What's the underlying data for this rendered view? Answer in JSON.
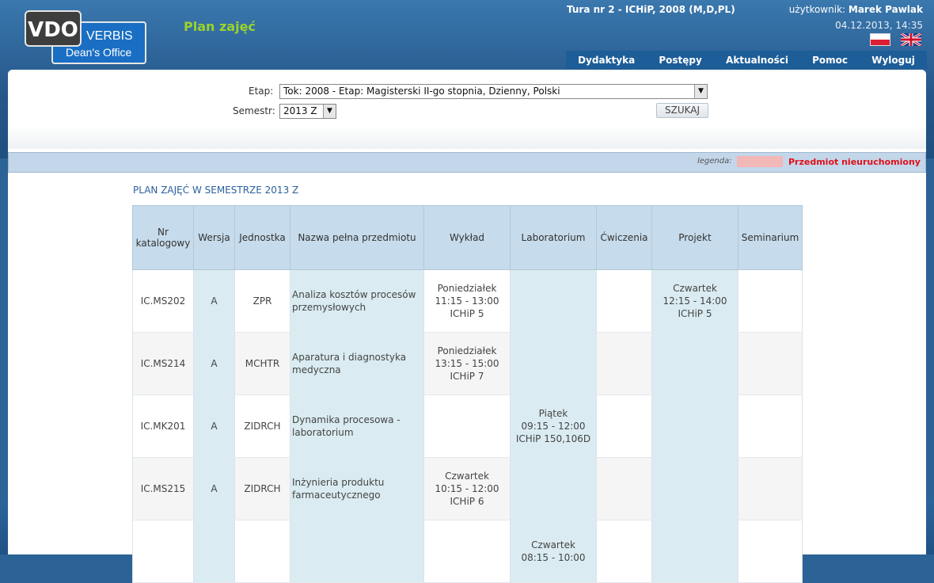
{
  "logo": {
    "vdo": "VDO",
    "verbis": "VERBIS",
    "dean": "Dean's Office"
  },
  "header": {
    "app_title": "Plan zajęć",
    "tura": "Tura nr 2 - ICHiP, 2008 (M,D,PL)",
    "user_label": "użytkownik:",
    "user_name": "Marek Pawlak",
    "datetime": "04.12.2013, 14:35"
  },
  "nav": [
    "Dydaktyka",
    "Postępy",
    "Aktualności",
    "Pomoc",
    "Wyloguj"
  ],
  "filters": {
    "etap_label": "Etap:",
    "etap_value": "Tok: 2008 - Etap: Magisterski II-go stopnia, Dzienny, Polski",
    "semestr_label": "Semestr:",
    "semestr_value": "2013 Z",
    "search_button": "SZUKAJ"
  },
  "legend": {
    "label": "legenda:",
    "text": "Przedmiot nieuruchomiony",
    "swatch_color": "#f2b7b7"
  },
  "plan_title": "PLAN ZAJĘĆ W SEMESTRZE 2013 Z",
  "table": {
    "headers": [
      "Nr katalogowy",
      "Wersja",
      "Jednostka",
      "Nazwa pełna przedmiotu",
      "Wykład",
      "Laboratorium",
      "Ćwiczenia",
      "Projekt",
      "Seminarium"
    ],
    "rows": [
      {
        "nr": "IC.MS202",
        "wersja": "A",
        "jednostka": "ZPR",
        "nazwa": "Analiza kosztów procesów przemysłowych",
        "wyklad": [
          "Poniedziałek",
          "11:15 - 13:00",
          "ICHiP 5"
        ],
        "laboratorium": [],
        "cwiczenia": [],
        "projekt": [
          "Czwartek",
          "12:15 - 14:00",
          "ICHiP 5"
        ],
        "seminarium": []
      },
      {
        "nr": "IC.MS214",
        "wersja": "A",
        "jednostka": "MCHTR",
        "nazwa": "Aparatura i diagnostyka medyczna",
        "wyklad": [
          "Poniedziałek",
          "13:15 - 15:00",
          "ICHiP 7"
        ],
        "laboratorium": [],
        "cwiczenia": [],
        "projekt": [],
        "seminarium": []
      },
      {
        "nr": "IC.MK201",
        "wersja": "A",
        "jednostka": "ZIDRCH",
        "nazwa": "Dynamika procesowa - laboratorium",
        "wyklad": [],
        "laboratorium": [
          "Piątek",
          "09:15 - 12:00",
          "ICHiP 150,106D"
        ],
        "cwiczenia": [],
        "projekt": [],
        "seminarium": []
      },
      {
        "nr": "IC.MS215",
        "wersja": "A",
        "jednostka": "ZIDRCH",
        "nazwa": "Inżynieria produktu farmaceutycznego",
        "wyklad": [
          "Czwartek",
          "10:15 - 12:00",
          "ICHiP 6"
        ],
        "laboratorium": [],
        "cwiczenia": [],
        "projekt": [],
        "seminarium": []
      },
      {
        "nr": "",
        "wersja": "",
        "jednostka": "",
        "nazwa": "",
        "wyklad": [],
        "laboratorium": [
          "Czwartek",
          "08:15 - 10:00"
        ],
        "cwiczenia": [],
        "projekt": [],
        "seminarium": []
      }
    ]
  }
}
